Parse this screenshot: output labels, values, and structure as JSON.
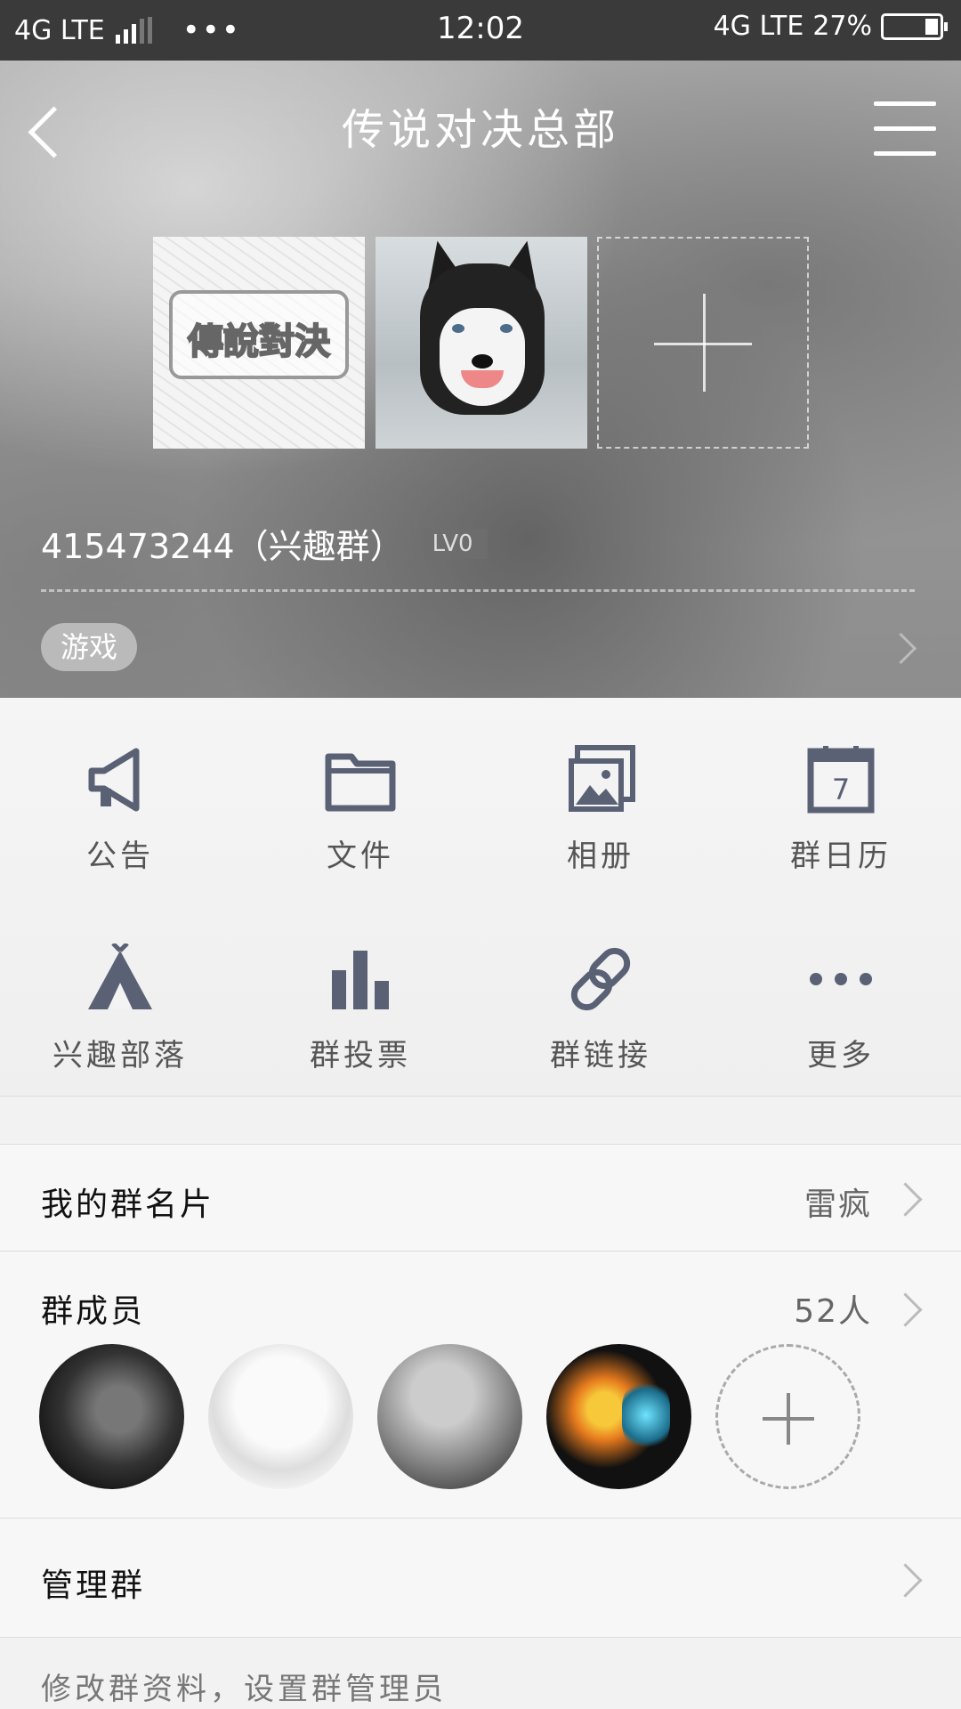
{
  "status_bar": {
    "left_network": "4G LTE",
    "left_dots": "•••",
    "time": "12:02",
    "right_network": "4G LTE",
    "battery": "27%"
  },
  "header": {
    "title": "传说对决总部",
    "photo1_text": "傳說對決",
    "group_id": "415473244（兴趣群）",
    "level": "LV0",
    "tag": "游戏"
  },
  "grid": [
    {
      "label": "公告",
      "icon": "megaphone-icon"
    },
    {
      "label": "文件",
      "icon": "folder-icon"
    },
    {
      "label": "相册",
      "icon": "album-icon"
    },
    {
      "label": "群日历",
      "icon": "calendar-icon",
      "day": "7"
    },
    {
      "label": "兴趣部落",
      "icon": "tent-icon"
    },
    {
      "label": "群投票",
      "icon": "bar-chart-icon"
    },
    {
      "label": "群链接",
      "icon": "link-icon"
    },
    {
      "label": "更多",
      "icon": "more-icon"
    }
  ],
  "rows": {
    "card": {
      "title": "我的群名片",
      "value": "雷疯"
    },
    "members": {
      "title": "群成员",
      "value": "52人"
    },
    "manage": {
      "title": "管理群"
    }
  },
  "footer_note": "修改群资料，设置群管理员",
  "colors": {
    "icon": "#5b6175",
    "header_bg": "#9a9a9a",
    "statusbar_bg": "#3a3a3a"
  }
}
